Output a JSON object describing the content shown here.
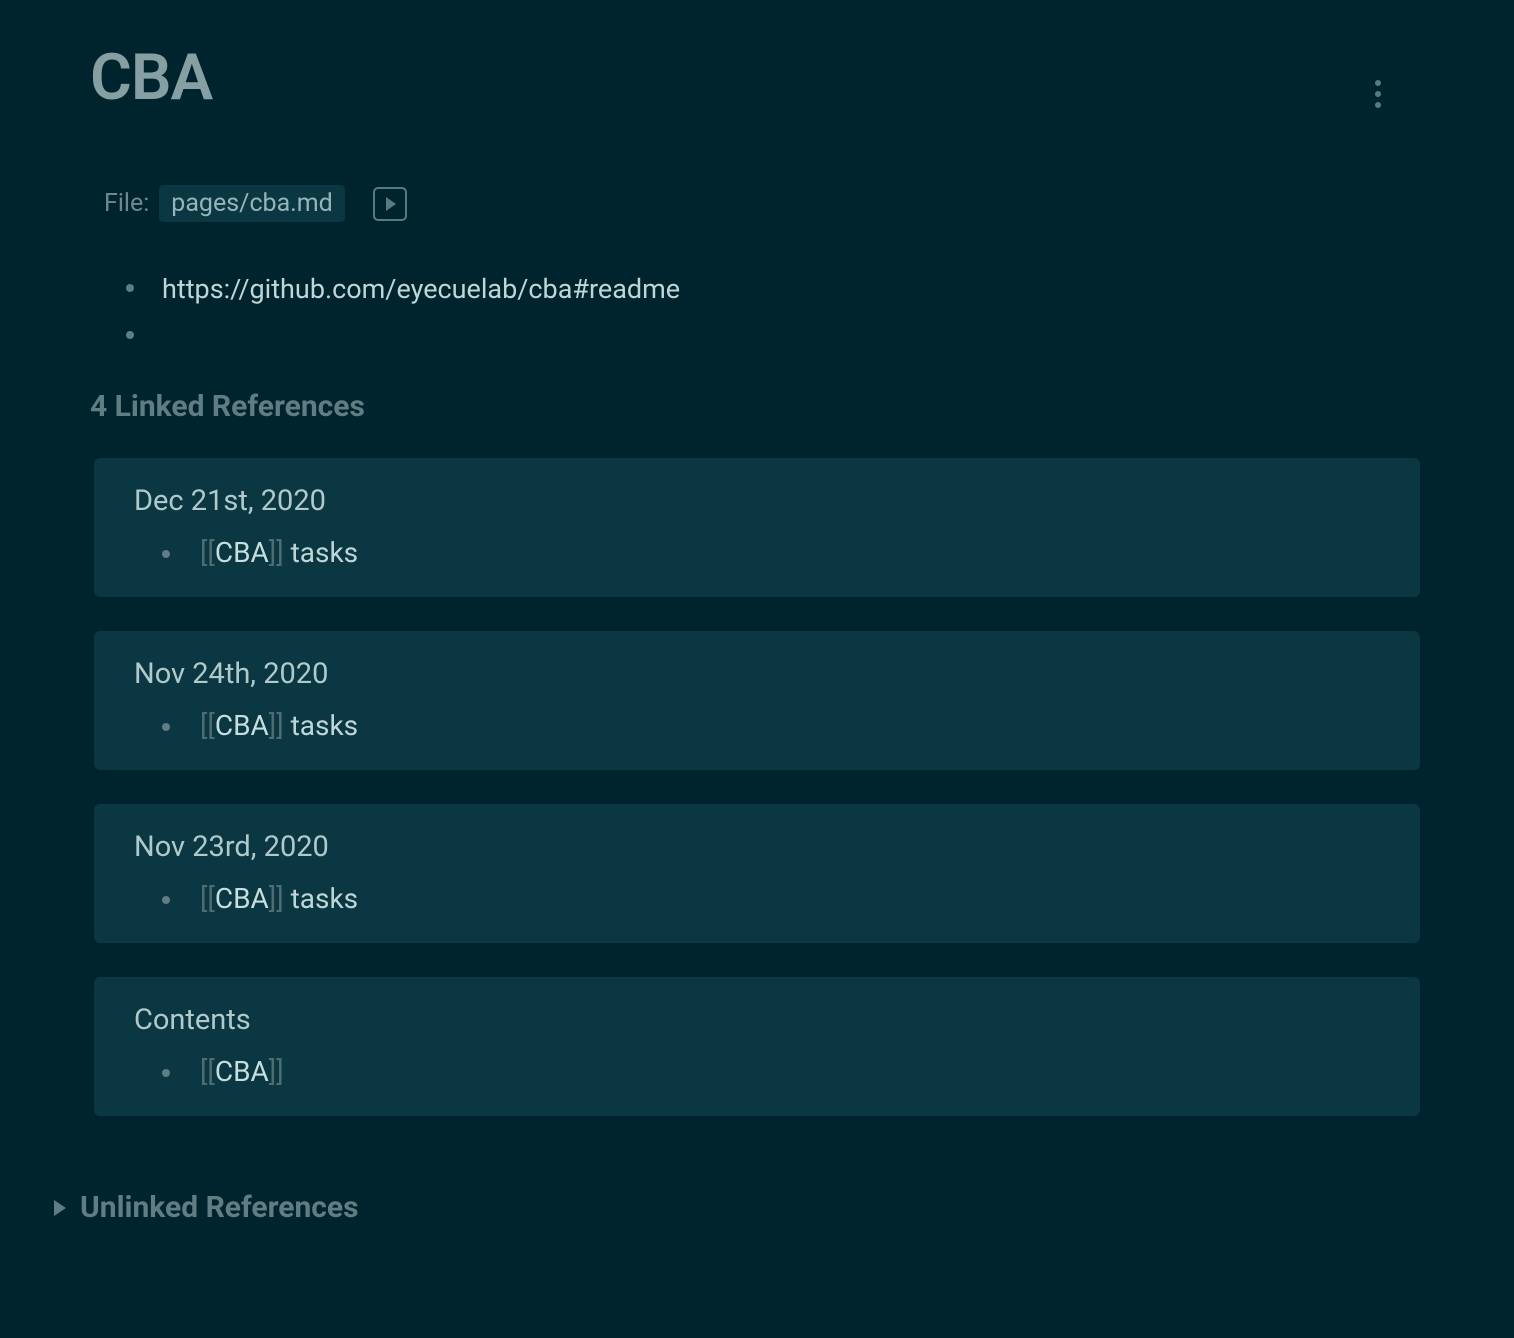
{
  "page_title": "CBA",
  "file": {
    "label": "File:",
    "path": "pages/cba.md"
  },
  "content_bullets": [
    "https://github.com/eyecuelab/cba#readme",
    ""
  ],
  "linked_references": {
    "heading": "4 Linked References",
    "items": [
      {
        "title": "Dec 21st, 2020",
        "link_text": "CBA",
        "suffix": " tasks"
      },
      {
        "title": "Nov 24th, 2020",
        "link_text": "CBA",
        "suffix": " tasks"
      },
      {
        "title": "Nov 23rd, 2020",
        "link_text": "CBA",
        "suffix": " tasks"
      },
      {
        "title": "Contents",
        "link_text": "CBA",
        "suffix": ""
      }
    ]
  },
  "unlinked_references": {
    "label": "Unlinked References"
  },
  "brackets": {
    "open": "[[",
    "close": "]]"
  }
}
